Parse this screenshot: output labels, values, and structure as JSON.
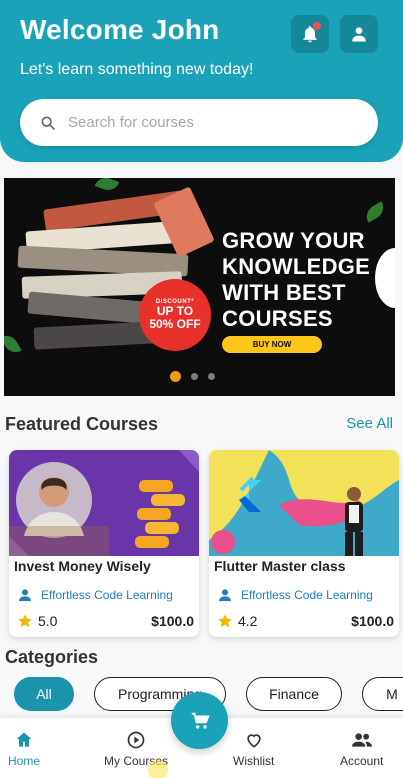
{
  "header": {
    "title": "Welcome John",
    "subtitle": "Let's learn something new today!",
    "search_placeholder": "Search for courses"
  },
  "banner": {
    "badge_small": "DISCOUNT*",
    "badge_big_1": "UP TO",
    "badge_big_2": "50% OFF",
    "headline_1": "GROW YOUR",
    "headline_2": "KNOWLEDGE",
    "headline_3": "WITH BEST",
    "headline_4": "COURSES",
    "cta": "BUY NOW",
    "slides": 3,
    "active_slide": 1
  },
  "featured": {
    "title": "Featured Courses",
    "see_all": "See All",
    "courses": [
      {
        "title": "Invest Money Wisely",
        "author": "Effortless Code Learning",
        "rating": "5.0",
        "price": "$100.0"
      },
      {
        "title": "Flutter Master class",
        "author": "Effortless Code Learning",
        "rating": "4.2",
        "price": "$100.0"
      }
    ]
  },
  "categories": {
    "title": "Categories",
    "items": [
      "All",
      "Programming",
      "Finance",
      "M"
    ]
  },
  "nav": {
    "home": "Home",
    "my_courses": "My Courses",
    "wishlist": "Wishlist",
    "account": "Account"
  },
  "colors": {
    "primary": "#1aa2b8",
    "accent": "#1a93ad",
    "star": "#f5b800",
    "badge": "#e8312a",
    "cta": "#ffc61a"
  }
}
